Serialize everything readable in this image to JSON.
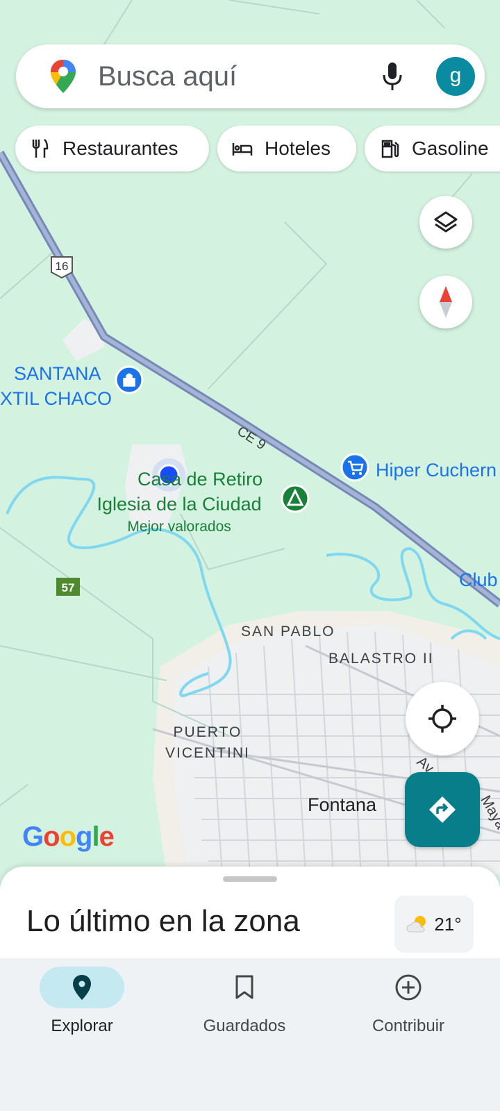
{
  "search": {
    "placeholder": "Busca aquí",
    "avatar_letter": "g"
  },
  "chips": [
    {
      "label": "Restaurantes",
      "icon": "restaurant-icon"
    },
    {
      "label": "Hoteles",
      "icon": "hotel-icon"
    },
    {
      "label": "Gasoline",
      "icon": "gas-station-icon"
    }
  ],
  "map": {
    "road_shields": {
      "ruta_16": "16",
      "ruta_57": "57",
      "ce9": "CE 9"
    },
    "places": {
      "santana_line1": "SANTANA",
      "santana_line2": "XTIL CHACO",
      "casa_line1": "Casa de Retiro",
      "casa_line2": "Iglesia de la Ciudad",
      "casa_sub": "Mejor valorados",
      "hiper": "Hiper Cuchern",
      "club": "Club"
    },
    "areas": {
      "san_pablo": "SAN PABLO",
      "balastro": "BALASTRO II",
      "puerto_line1": "PUERTO",
      "puerto_line2": "VICENTINI",
      "fontana": "Fontana",
      "av": "Av",
      "mayo": "Maya"
    }
  },
  "branding": {
    "google": [
      "G",
      "o",
      "o",
      "g",
      "l",
      "e"
    ],
    "google_colors": [
      "#4285F4",
      "#EA4335",
      "#FBBC05",
      "#4285F4",
      "#34A853",
      "#EA4335"
    ]
  },
  "sheet": {
    "title": "Lo último en la zona",
    "temperature": "21°"
  },
  "nav": {
    "items": [
      {
        "label": "Explorar",
        "icon": "explore-pin-icon",
        "active": true
      },
      {
        "label": "Guardados",
        "icon": "bookmark-icon",
        "active": false
      },
      {
        "label": "Contribuir",
        "icon": "add-circle-icon",
        "active": false
      }
    ]
  },
  "colors": {
    "map_green": "#d4f2e0",
    "road": "#8b9dc3",
    "river": "#80d8f0",
    "urban": "#f1f3f4",
    "accent_teal": "#087e8b",
    "place_blue": "#1a73e8",
    "place_green": "#188038"
  }
}
